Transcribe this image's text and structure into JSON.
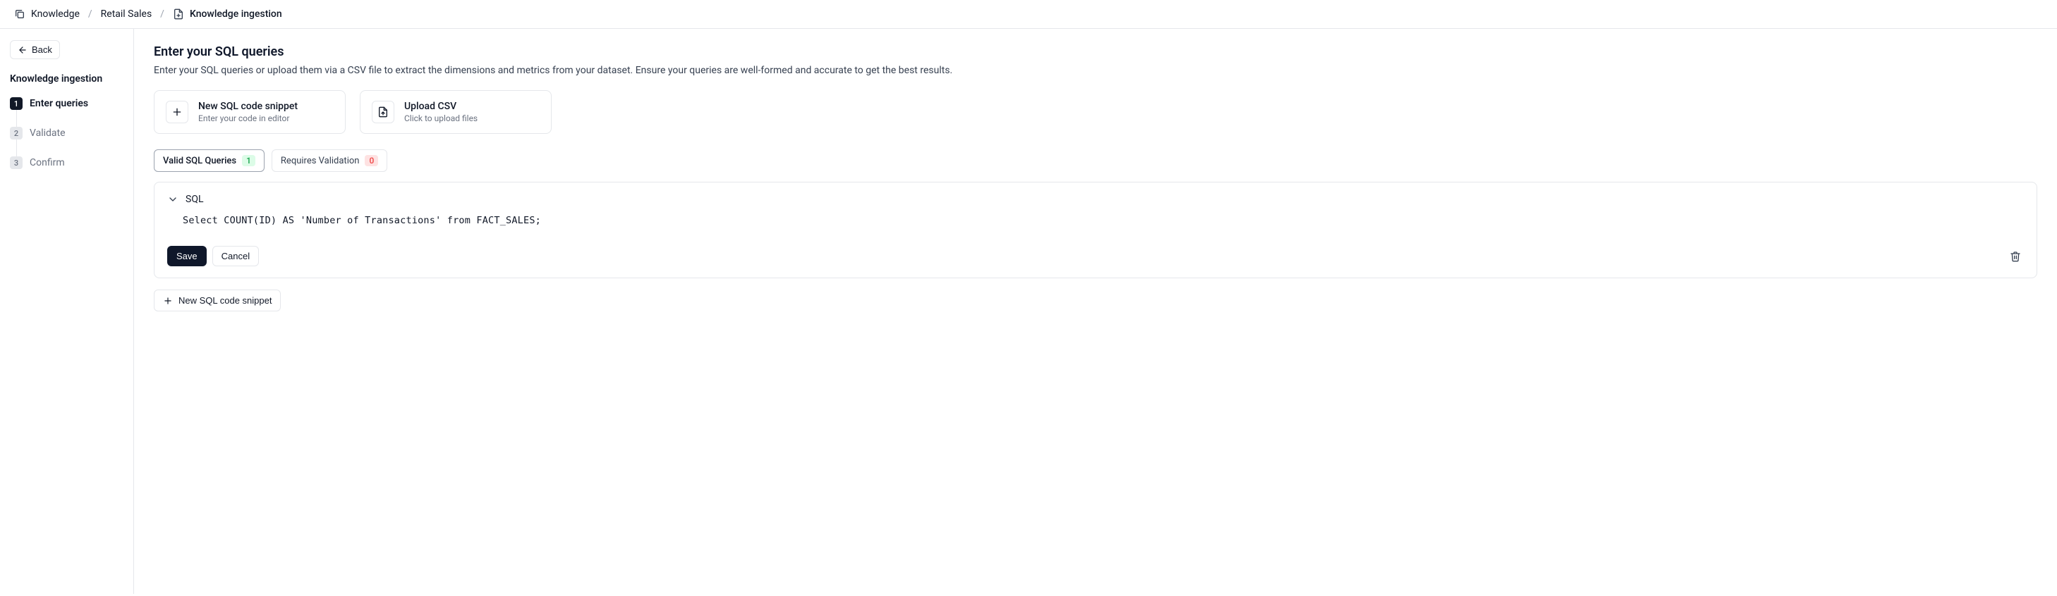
{
  "breadcrumb": {
    "item1": "Knowledge",
    "item2": "Retail Sales",
    "item3": "Knowledge ingestion"
  },
  "sidebar": {
    "back_label": "Back",
    "title": "Knowledge ingestion",
    "steps": [
      {
        "num": "1",
        "label": "Enter queries"
      },
      {
        "num": "2",
        "label": "Validate"
      },
      {
        "num": "3",
        "label": "Confirm"
      }
    ]
  },
  "main": {
    "title": "Enter your SQL queries",
    "description": "Enter your SQL queries or upload them via a CSV file to extract the dimensions and metrics from your dataset. Ensure your queries are well-formed and accurate to get the best results.",
    "cards": {
      "new_snippet": {
        "title": "New SQL code snippet",
        "subtitle": "Enter your code in editor"
      },
      "upload_csv": {
        "title": "Upload CSV",
        "subtitle": "Click to upload files"
      }
    },
    "tabs": {
      "valid": {
        "label": "Valid SQL Queries",
        "count": "1"
      },
      "requires": {
        "label": "Requires Validation",
        "count": "0"
      }
    },
    "query": {
      "label": "SQL",
      "code": "Select COUNT(ID) AS 'Number of Transactions' from FACT_SALES;",
      "save_label": "Save",
      "cancel_label": "Cancel"
    },
    "new_snippet_button": "New SQL code snippet"
  }
}
